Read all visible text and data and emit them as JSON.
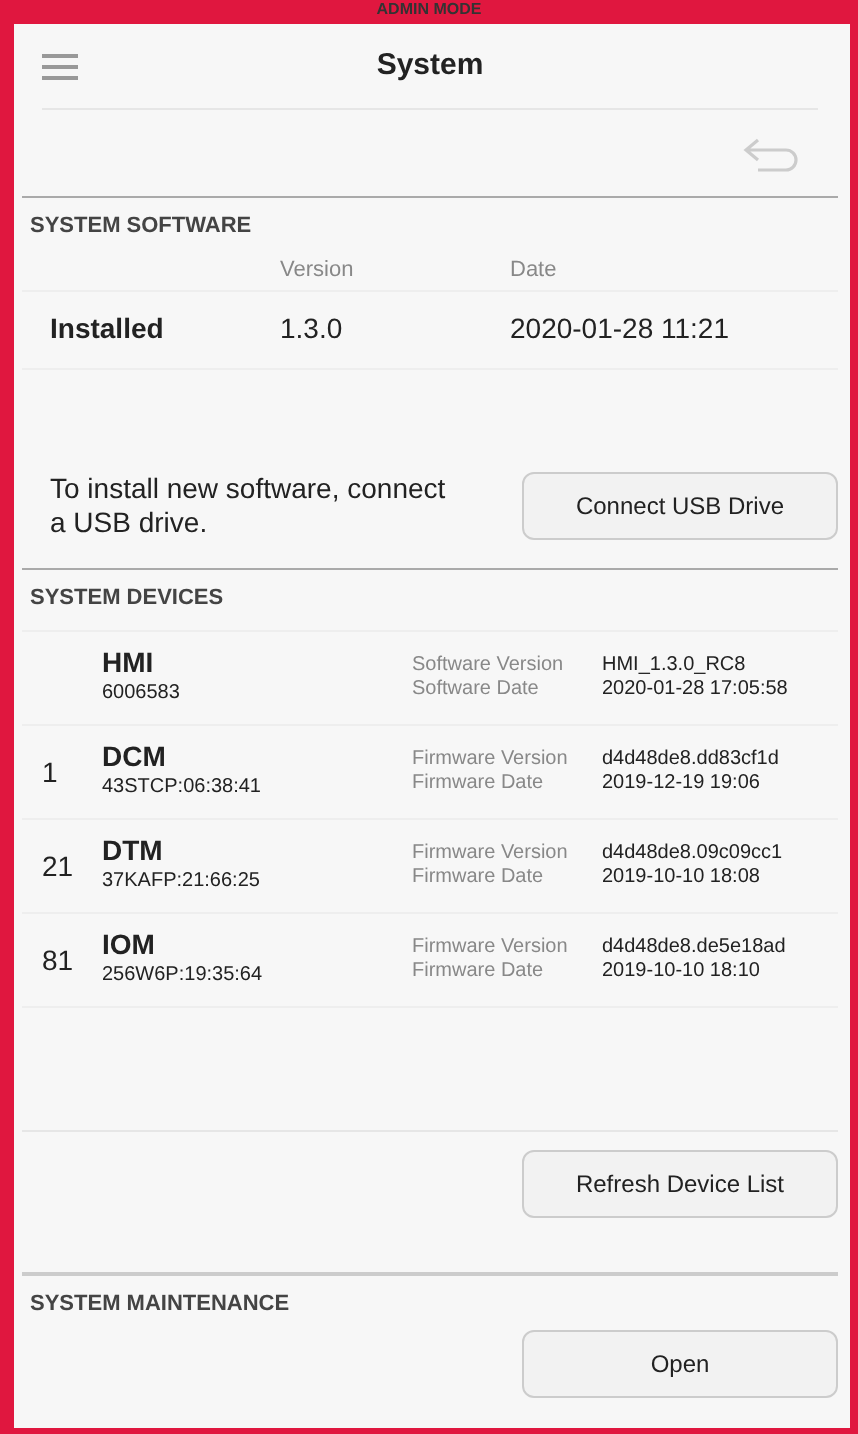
{
  "mode_banner": "ADMIN MODE",
  "header": {
    "title": "System"
  },
  "system_software": {
    "title": "SYSTEM SOFTWARE",
    "columns": [
      "Version",
      "Date"
    ],
    "rows": [
      {
        "label": "Installed",
        "version": "1.3.0",
        "date": "2020-01-28 11:21"
      }
    ],
    "install_note": "To install new software, connect a USB drive.",
    "button": "Connect USB Drive"
  },
  "system_devices": {
    "title": "SYSTEM DEVICES",
    "devices": [
      {
        "name": "HMI",
        "serial": "6006583",
        "label_1": "Software Version",
        "label_2": "Software Date",
        "value_1": "HMI_1.3.0_RC8",
        "value_2": "2020-01-28 17:05:58"
      },
      {
        "address": "1",
        "name": "DCM",
        "serial": "43STCP:06:38:41",
        "label_1": "Firmware Version",
        "label_2": "Firmware Date",
        "value_1": "d4d48de8.dd83cf1d",
        "value_2": "2019-12-19 19:06"
      },
      {
        "address": "21",
        "name": "DTM",
        "serial": "37KAFP:21:66:25",
        "label_1": "Firmware Version",
        "label_2": "Firmware Date",
        "value_1": "d4d48de8.09c09cc1",
        "value_2": "2019-10-10 18:08"
      },
      {
        "address": "81",
        "name": "IOM",
        "serial": "256W6P:19:35:64",
        "label_1": "Firmware Version",
        "label_2": "Firmware Date",
        "value_1": "d4d48de8.de5e18ad",
        "value_2": "2019-10-10 18:10"
      }
    ],
    "button": "Refresh Device List"
  },
  "system_maintenance": {
    "title": "SYSTEM MAINTENANCE",
    "button": "Open"
  }
}
